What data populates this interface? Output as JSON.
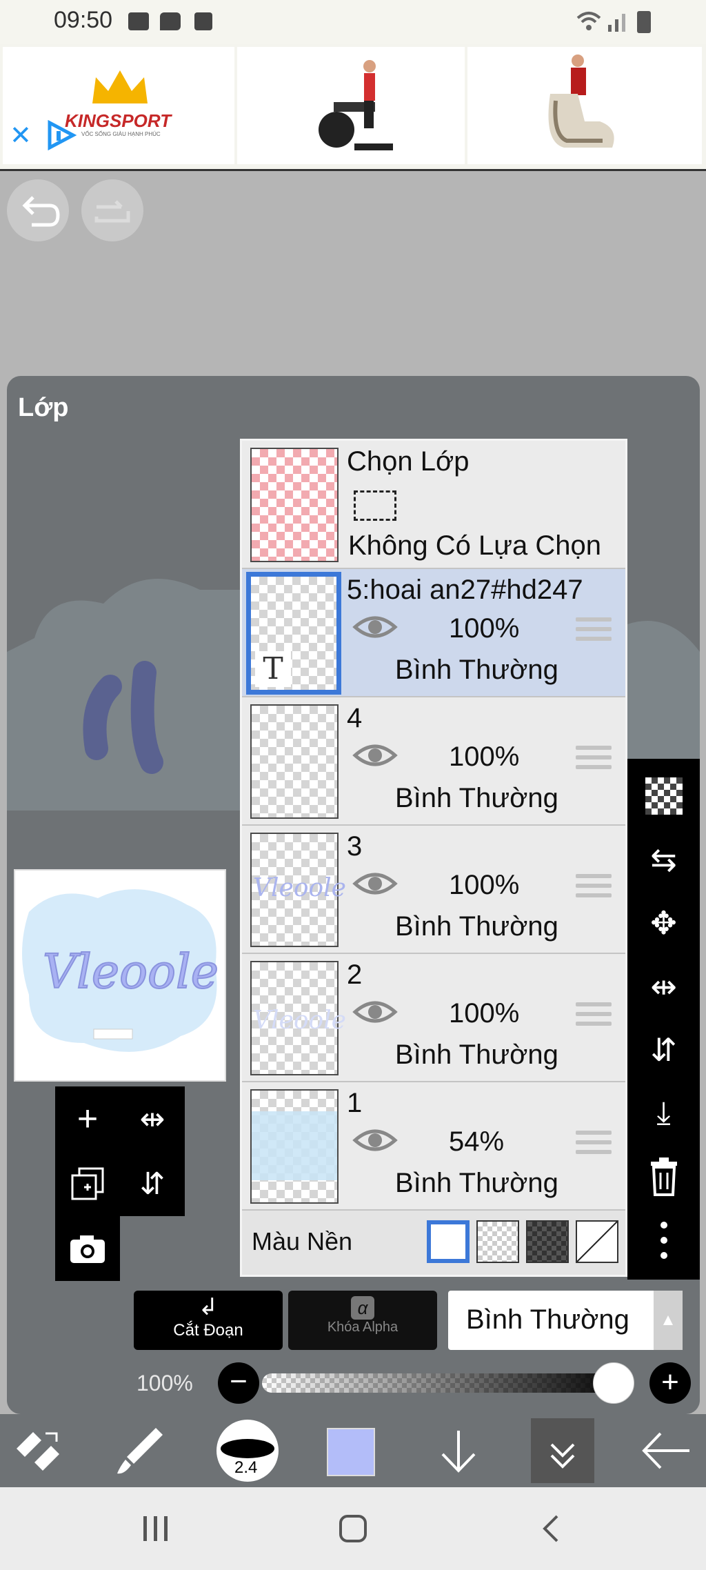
{
  "status_bar": {
    "time": "09:50"
  },
  "ad": {
    "brand": "KINGSPORT",
    "tagline": "VỐC SỐNG GIÀU HẠNH PHÚC"
  },
  "panel": {
    "title": "Lớp"
  },
  "selection_row": {
    "title": "Chọn Lớp",
    "subtitle": "Không Có Lựa Chọn"
  },
  "layers": [
    {
      "name": "5:hoai an27#hd247",
      "opacity": "100%",
      "mode": "Bình Thường",
      "selected": true
    },
    {
      "name": "4",
      "opacity": "100%",
      "mode": "Bình Thường",
      "selected": false
    },
    {
      "name": "3",
      "opacity": "100%",
      "mode": "Bình Thường",
      "selected": false
    },
    {
      "name": "2",
      "opacity": "100%",
      "mode": "Bình Thường",
      "selected": false
    },
    {
      "name": "1",
      "opacity": "54%",
      "mode": "Bình Thường",
      "selected": false
    }
  ],
  "background_row": {
    "label": "Màu Nền"
  },
  "controls": {
    "clip_label": "Cắt Đoạn",
    "alpha_lock_label": "Khóa Alpha",
    "blend_mode": "Bình Thường",
    "opacity_value": "100%",
    "opacity_fraction": 1.0
  },
  "toolbar": {
    "brush_size": "2.4",
    "color": "#b3bdf9"
  },
  "preview_text": "Vleoole",
  "colors": {
    "panel": "#6e7275",
    "selected_row": "#cdd8ec",
    "accent": "#3c78d8"
  }
}
